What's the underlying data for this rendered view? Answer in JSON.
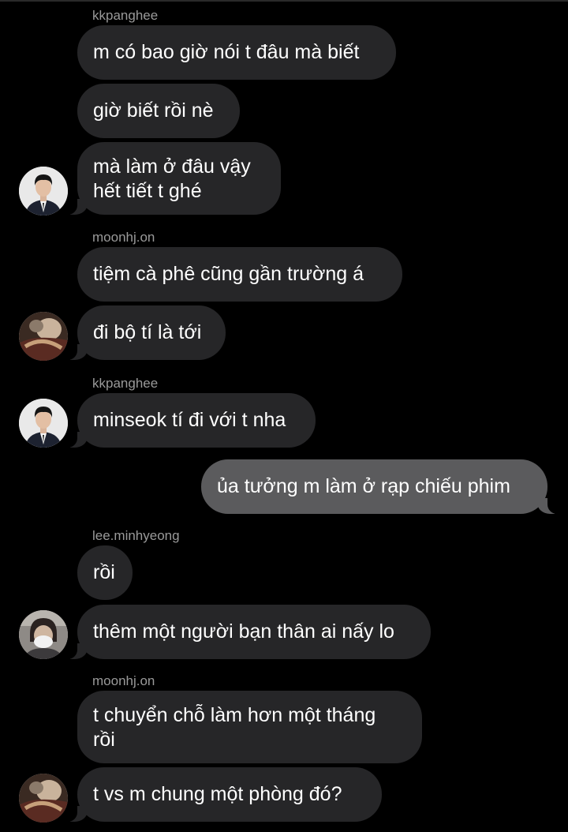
{
  "colors": {
    "background": "#000000",
    "incoming_bubble": "#262628",
    "outgoing_bubble": "#5b5b5d",
    "sender_text": "#9a9a9a",
    "message_text": "#ffffff"
  },
  "messages": [
    {
      "sender": "kkpanghee",
      "text": "m có bao giờ nói t đâu mà biết"
    },
    {
      "text": "giờ biết rồi nè"
    },
    {
      "text": "mà làm ở đâu vậy\nhết tiết t ghé",
      "avatar": "portrait-suit-avatar"
    },
    {
      "sender": "moonhj.on",
      "text": "tiệm cà phê cũng gần trường á"
    },
    {
      "text": "đi bộ tí là tới",
      "avatar": "blurred-photo-avatar"
    },
    {
      "sender": "kkpanghee",
      "text": "minseok tí đi với t nha",
      "avatar": "portrait-suit-avatar"
    },
    {
      "text": "ủa tưởng m làm ở rạp chiếu phim",
      "outgoing": true
    },
    {
      "sender": "lee.minhyeong",
      "text": "rồi"
    },
    {
      "text": "thêm một người bạn thân ai nấy lo",
      "avatar": "masked-selfie-avatar"
    },
    {
      "sender": "moonhj.on",
      "text": "t chuyển chỗ làm hơn một tháng\nrồi"
    },
    {
      "text": "t vs m chung một phòng đó?",
      "avatar": "blurred-photo-avatar"
    }
  ]
}
